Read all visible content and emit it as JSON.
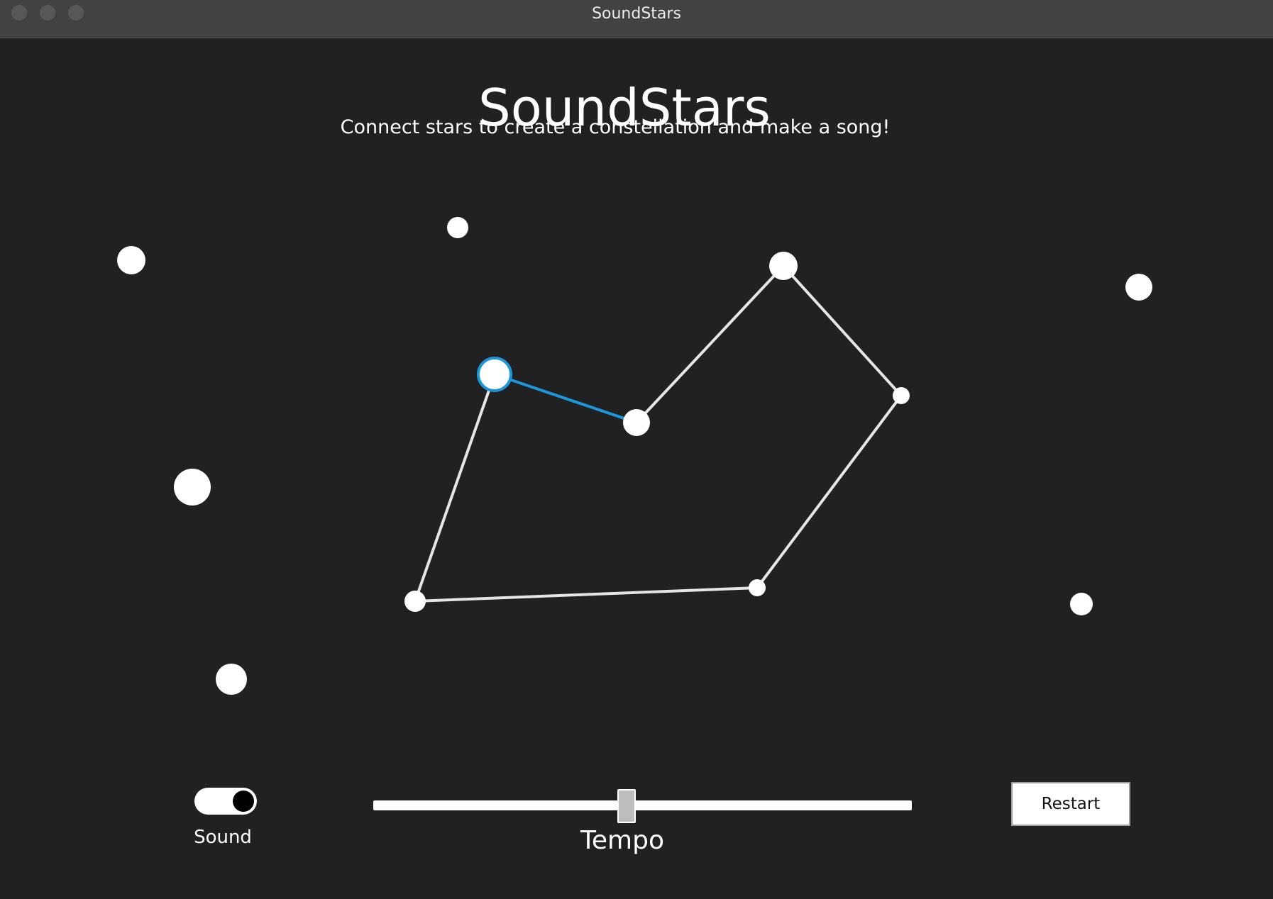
{
  "window": {
    "title": "SoundStars"
  },
  "app": {
    "title": "SoundStars",
    "subtitle": "Connect stars to create a constellation and make a song!"
  },
  "stars": [
    {
      "id": "s1",
      "selected": false
    },
    {
      "id": "s2",
      "selected": false
    },
    {
      "id": "s3",
      "selected": false
    },
    {
      "id": "s4",
      "selected": false
    },
    {
      "id": "s5",
      "selected": false
    },
    {
      "id": "s6",
      "selected": false
    },
    {
      "id": "s7",
      "selected": false
    },
    {
      "id": "s8",
      "selected": false
    },
    {
      "id": "s9",
      "selected": true
    },
    {
      "id": "s10",
      "selected": false
    },
    {
      "id": "s11",
      "selected": false
    },
    {
      "id": "s12",
      "selected": false
    },
    {
      "id": "s13",
      "selected": false
    }
  ],
  "connections": [
    {
      "from": "s10",
      "to": "s9",
      "active": false
    },
    {
      "from": "s9",
      "to": "s8",
      "active": true
    },
    {
      "from": "s8",
      "to": "s5",
      "active": false
    },
    {
      "from": "s5",
      "to": "s11",
      "active": false
    },
    {
      "from": "s11",
      "to": "s12",
      "active": false
    },
    {
      "from": "s12",
      "to": "s10",
      "active": false
    }
  ],
  "colors": {
    "background": "#212121",
    "star": "#ffffff",
    "line": "#e6e6e6",
    "active_line": "#1e96dc"
  },
  "controls": {
    "sound_label": "Sound",
    "sound_on": true,
    "tempo_label": "Tempo",
    "tempo_value": 0.47,
    "restart_label": "Restart"
  }
}
